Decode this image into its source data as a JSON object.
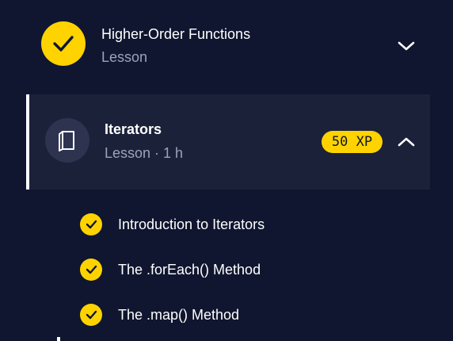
{
  "colors": {
    "background": "#10162f",
    "active_row": "#1b2139",
    "accent": "#ffd300",
    "muted_text": "#9ca3b8"
  },
  "lessons": [
    {
      "title": "Higher-Order Functions",
      "subtitle": "Lesson",
      "status_icon": "check-icon",
      "toggle_icon": "chevron-down-icon"
    },
    {
      "title": "Iterators",
      "subtitle": "Lesson · 1 h",
      "icon": "book-icon",
      "xp": "50 XP",
      "toggle_icon": "chevron-up-icon",
      "items": [
        {
          "label": "Introduction to Iterators",
          "icon": "check-icon"
        },
        {
          "label": "The .forEach() Method",
          "icon": "check-icon"
        },
        {
          "label": "The .map() Method",
          "icon": "check-icon"
        }
      ]
    }
  ]
}
